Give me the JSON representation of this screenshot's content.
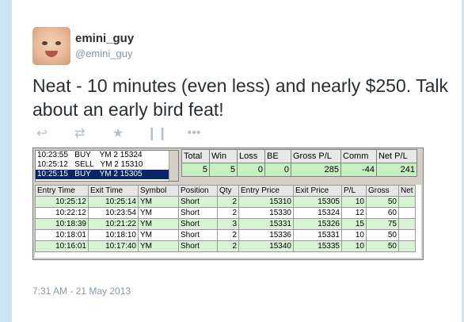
{
  "user": {
    "name": "emini_guy",
    "handle": "@emini_guy"
  },
  "tweet": {
    "text": "Neat - 10 minutes (even less) and nearly $250. Talk about an early bird feat!",
    "timestamp": "7:31 AM - 21 May 2013"
  },
  "actions": [
    "reply-icon",
    "retweet-icon",
    "favorite-icon",
    "analytics-icon",
    "more-icon"
  ],
  "orders": [
    {
      "time": "10:23:55",
      "side": "BUY",
      "detail": "YM 2 15324",
      "selected": false
    },
    {
      "time": "10:25:12",
      "side": "SELL",
      "detail": "YM 2 15310",
      "selected": false
    },
    {
      "time": "10:25:15",
      "side": "BUY",
      "detail": "YM 2 15305",
      "selected": true
    }
  ],
  "summary": {
    "headers": [
      "Total",
      "Win",
      "Loss",
      "BE",
      "Gross P/L",
      "Comm",
      "Net P/L"
    ],
    "values": [
      "5",
      "5",
      "0",
      "0",
      "285",
      "-44",
      "241"
    ]
  },
  "trades": {
    "headers": [
      "Entry Time",
      "Exit Time",
      "Symbol",
      "Position",
      "Qty",
      "Entry Price",
      "Exit Price",
      "P/L",
      "Gross",
      "Net"
    ],
    "rows": [
      [
        "10:25:12",
        "10:25:14",
        "YM",
        "Short",
        "2",
        "15310",
        "15305",
        "10",
        "50",
        ""
      ],
      [
        "10:22:12",
        "10:23:54",
        "YM",
        "Short",
        "2",
        "15330",
        "15324",
        "12",
        "60",
        ""
      ],
      [
        "10:18:39",
        "10:21:22",
        "YM",
        "Short",
        "3",
        "15331",
        "15326",
        "15",
        "75",
        ""
      ],
      [
        "10:18:01",
        "10:18:10",
        "YM",
        "Short",
        "2",
        "15336",
        "15331",
        "10",
        "50",
        ""
      ],
      [
        "10:16:01",
        "10:17:40",
        "YM",
        "Short",
        "2",
        "15340",
        "15335",
        "10",
        "50",
        ""
      ]
    ]
  },
  "colors": {
    "summary_values_bg": "#c6efc2",
    "row_alt_bg": "#d9f2d6",
    "selected_bg": "#0a246a"
  }
}
